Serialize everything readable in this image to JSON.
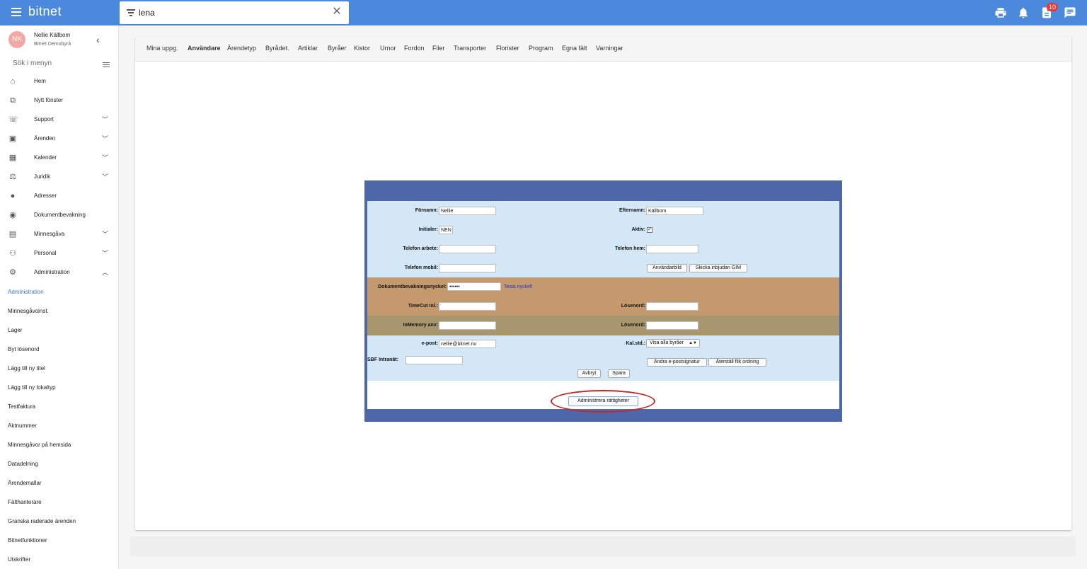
{
  "app": {
    "brand": "bitnet"
  },
  "search": {
    "value": "lena"
  },
  "topbar": {
    "notifications_badge": "10"
  },
  "user": {
    "initials": "NK",
    "name": "Nellie Källbom",
    "org": "Bitnet Demobyrå"
  },
  "sidebar": {
    "search_placeholder": "Sök i menyn",
    "items": [
      {
        "label": "Hem",
        "icon": "home-icon"
      },
      {
        "label": "Nytt fönster",
        "icon": "open-new-icon"
      },
      {
        "label": "Support",
        "icon": "phone-icon",
        "expandable": true
      },
      {
        "label": "Ärenden",
        "icon": "assignment-icon",
        "expandable": true
      },
      {
        "label": "Kalender",
        "icon": "calendar-icon",
        "expandable": true
      },
      {
        "label": "Juridik",
        "icon": "gavel-icon",
        "expandable": true
      },
      {
        "label": "Adresser",
        "icon": "location-pin-icon"
      },
      {
        "label": "Dokumentbevakning",
        "icon": "document-watch-icon"
      },
      {
        "label": "Minnesgåva",
        "icon": "gift-icon",
        "expandable": true
      },
      {
        "label": "Personal",
        "icon": "people-icon",
        "expandable": true
      },
      {
        "label": "Administration",
        "icon": "gear-icon",
        "expanded": true
      }
    ],
    "sub_items": [
      "Administration",
      "Minnesgåvoinst.",
      "Lager",
      "Byt lösenord",
      "Lägg till ny titel",
      "Lägg till ny lokaltyp",
      "Testfaktura",
      "Aktnummer",
      "Minnesgåvor på hemsida",
      "Datadelning",
      "Ärendemallar",
      "Fälthanterare",
      "Granska raderade ärenden",
      "Bitnetfunktioner",
      "Utskrifter"
    ]
  },
  "tabs": [
    "Mina uppg.",
    "Användare",
    "Ärendetyp",
    "Byrådet.",
    "Artiklar",
    "Byråer",
    "Kistor",
    "Urnor",
    "Fordon",
    "Filer",
    "Transporter",
    "Florister",
    "Program",
    "Egna fält",
    "Varningar"
  ],
  "form": {
    "fornamn_label": "Förnamn:",
    "fornamn_value": "Nellie",
    "efternamn_label": "Efternamn:",
    "efternamn_value": "Källbom",
    "initialer_label": "Initialer:",
    "initialer_value": "NEN",
    "aktiv_label": "Aktiv:",
    "aktiv_checked": "✓",
    "tel_arbete_label": "Telefon arbete:",
    "tel_hem_label": "Telefon hem:",
    "tel_mobil_label": "Telefon mobil:",
    "anvandarbild_button": "Användarbild",
    "skicka_button": "Skicka inbjudan GIM",
    "dok_label": "Dokumentbevakningsnyckel:",
    "dok_value": "••••••",
    "testa_link": "Testa nyckel!",
    "timecut_label": "TimeCut Inl.:",
    "losenord_label": "Lösenord:",
    "inmemory_label": "InMemory anv:",
    "losenord2_label": "Lösenord:",
    "epost_label": "e-post:",
    "epost_value": "nellie@bitnet.nu",
    "kalstd_label": "Kal.std.:",
    "kalstd_value": "Visa alla byråer",
    "sbf_label": "SBF Intranät:",
    "andra_button": "Ändra e-postsignatur",
    "aterstall_button": "Återställ flik ordning",
    "avbryt_button": "Avbryt",
    "spara_button": "Spara",
    "admin_rights_button": "Administrera rättigheter"
  }
}
